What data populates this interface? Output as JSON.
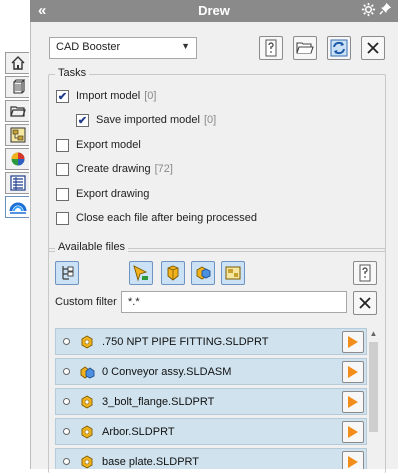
{
  "window": {
    "title": "Drew",
    "collapse_glyph": "«"
  },
  "colors": {
    "titlebar": "#8a8a8a",
    "panel": "#f0f0f0",
    "row_highlight": "#cfe2ee",
    "play_orange": "#f28c1a",
    "toggle_active": "#cbe1f5"
  },
  "side_tabs": [
    {
      "icon": "home-icon"
    },
    {
      "icon": "parts-icon"
    },
    {
      "icon": "folder-icon"
    },
    {
      "icon": "tree-icon"
    },
    {
      "icon": "appearance-icon"
    },
    {
      "icon": "properties-list-icon"
    },
    {
      "icon": "cad-booster-icon"
    }
  ],
  "toolbar": {
    "selected_profile": "CAD Booster",
    "buttons": [
      "help-icon",
      "open-folder-icon",
      "refresh-icon",
      "close-icon"
    ]
  },
  "tasks": {
    "label": "Tasks",
    "items": [
      {
        "label": "Import model",
        "count": "[0]",
        "checked": true
      },
      {
        "label": "Save imported model",
        "count": "[0]",
        "checked": true,
        "indent": true
      },
      {
        "label": "Export model",
        "count": "",
        "checked": false
      },
      {
        "label": "Create drawing",
        "count": "[72]",
        "checked": false
      },
      {
        "label": "Export drawing",
        "count": "",
        "checked": false
      },
      {
        "label": "Close each file after being processed",
        "count": "",
        "checked": false
      }
    ]
  },
  "available_files": {
    "label": "Available files",
    "filter_label": "Custom filter",
    "filter_value": "*.*",
    "files": [
      {
        "name": ".750 NPT PIPE FITTING.SLDPRT",
        "type": "part"
      },
      {
        "name": "0 Conveyor assy.SLDASM",
        "type": "assembly"
      },
      {
        "name": "3_bolt_flange.SLDPRT",
        "type": "part"
      },
      {
        "name": "Arbor.SLDPRT",
        "type": "part"
      },
      {
        "name": "base plate.SLDPRT",
        "type": "part"
      }
    ]
  }
}
